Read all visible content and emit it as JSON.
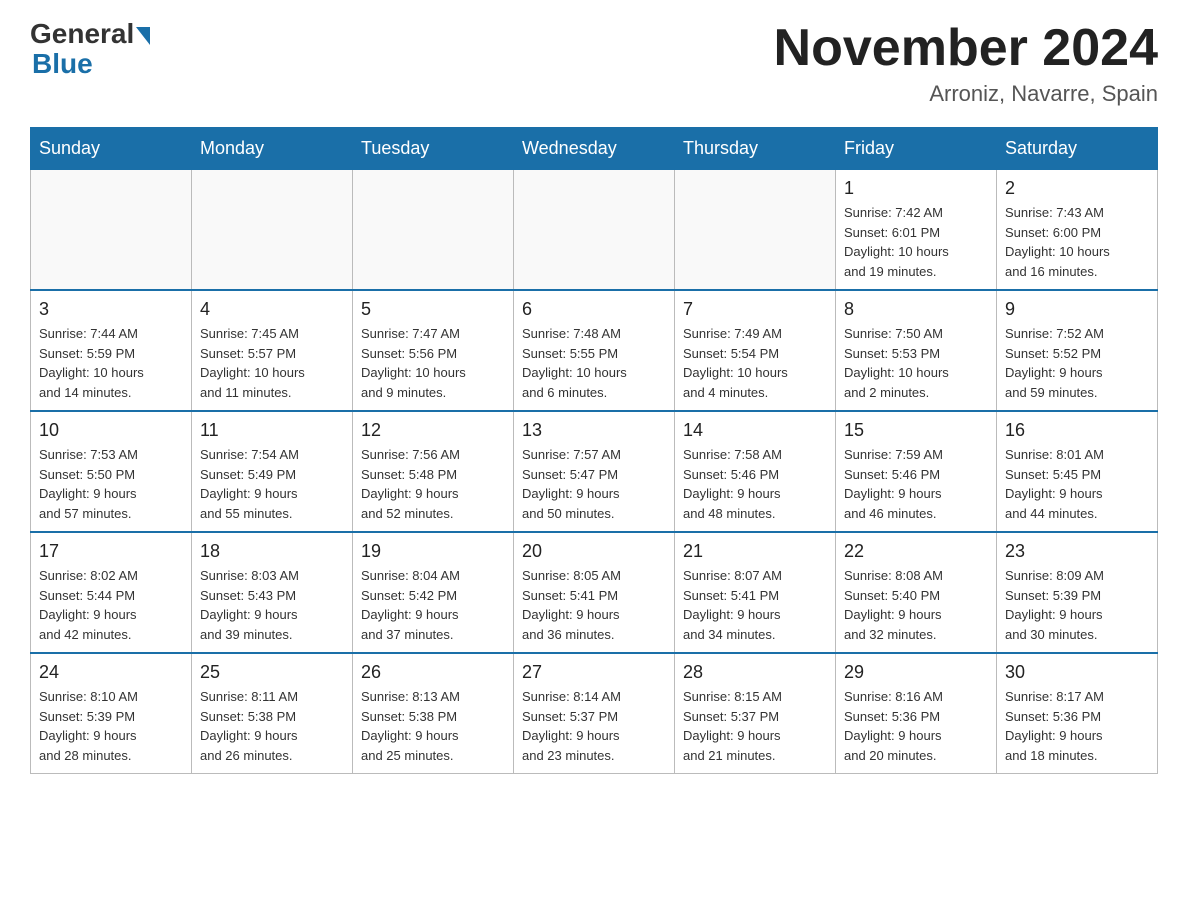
{
  "logo": {
    "general": "General",
    "blue": "Blue"
  },
  "title": "November 2024",
  "subtitle": "Arroniz, Navarre, Spain",
  "weekdays": [
    "Sunday",
    "Monday",
    "Tuesday",
    "Wednesday",
    "Thursday",
    "Friday",
    "Saturday"
  ],
  "weeks": [
    [
      {
        "day": "",
        "info": ""
      },
      {
        "day": "",
        "info": ""
      },
      {
        "day": "",
        "info": ""
      },
      {
        "day": "",
        "info": ""
      },
      {
        "day": "",
        "info": ""
      },
      {
        "day": "1",
        "info": "Sunrise: 7:42 AM\nSunset: 6:01 PM\nDaylight: 10 hours\nand 19 minutes."
      },
      {
        "day": "2",
        "info": "Sunrise: 7:43 AM\nSunset: 6:00 PM\nDaylight: 10 hours\nand 16 minutes."
      }
    ],
    [
      {
        "day": "3",
        "info": "Sunrise: 7:44 AM\nSunset: 5:59 PM\nDaylight: 10 hours\nand 14 minutes."
      },
      {
        "day": "4",
        "info": "Sunrise: 7:45 AM\nSunset: 5:57 PM\nDaylight: 10 hours\nand 11 minutes."
      },
      {
        "day": "5",
        "info": "Sunrise: 7:47 AM\nSunset: 5:56 PM\nDaylight: 10 hours\nand 9 minutes."
      },
      {
        "day": "6",
        "info": "Sunrise: 7:48 AM\nSunset: 5:55 PM\nDaylight: 10 hours\nand 6 minutes."
      },
      {
        "day": "7",
        "info": "Sunrise: 7:49 AM\nSunset: 5:54 PM\nDaylight: 10 hours\nand 4 minutes."
      },
      {
        "day": "8",
        "info": "Sunrise: 7:50 AM\nSunset: 5:53 PM\nDaylight: 10 hours\nand 2 minutes."
      },
      {
        "day": "9",
        "info": "Sunrise: 7:52 AM\nSunset: 5:52 PM\nDaylight: 9 hours\nand 59 minutes."
      }
    ],
    [
      {
        "day": "10",
        "info": "Sunrise: 7:53 AM\nSunset: 5:50 PM\nDaylight: 9 hours\nand 57 minutes."
      },
      {
        "day": "11",
        "info": "Sunrise: 7:54 AM\nSunset: 5:49 PM\nDaylight: 9 hours\nand 55 minutes."
      },
      {
        "day": "12",
        "info": "Sunrise: 7:56 AM\nSunset: 5:48 PM\nDaylight: 9 hours\nand 52 minutes."
      },
      {
        "day": "13",
        "info": "Sunrise: 7:57 AM\nSunset: 5:47 PM\nDaylight: 9 hours\nand 50 minutes."
      },
      {
        "day": "14",
        "info": "Sunrise: 7:58 AM\nSunset: 5:46 PM\nDaylight: 9 hours\nand 48 minutes."
      },
      {
        "day": "15",
        "info": "Sunrise: 7:59 AM\nSunset: 5:46 PM\nDaylight: 9 hours\nand 46 minutes."
      },
      {
        "day": "16",
        "info": "Sunrise: 8:01 AM\nSunset: 5:45 PM\nDaylight: 9 hours\nand 44 minutes."
      }
    ],
    [
      {
        "day": "17",
        "info": "Sunrise: 8:02 AM\nSunset: 5:44 PM\nDaylight: 9 hours\nand 42 minutes."
      },
      {
        "day": "18",
        "info": "Sunrise: 8:03 AM\nSunset: 5:43 PM\nDaylight: 9 hours\nand 39 minutes."
      },
      {
        "day": "19",
        "info": "Sunrise: 8:04 AM\nSunset: 5:42 PM\nDaylight: 9 hours\nand 37 minutes."
      },
      {
        "day": "20",
        "info": "Sunrise: 8:05 AM\nSunset: 5:41 PM\nDaylight: 9 hours\nand 36 minutes."
      },
      {
        "day": "21",
        "info": "Sunrise: 8:07 AM\nSunset: 5:41 PM\nDaylight: 9 hours\nand 34 minutes."
      },
      {
        "day": "22",
        "info": "Sunrise: 8:08 AM\nSunset: 5:40 PM\nDaylight: 9 hours\nand 32 minutes."
      },
      {
        "day": "23",
        "info": "Sunrise: 8:09 AM\nSunset: 5:39 PM\nDaylight: 9 hours\nand 30 minutes."
      }
    ],
    [
      {
        "day": "24",
        "info": "Sunrise: 8:10 AM\nSunset: 5:39 PM\nDaylight: 9 hours\nand 28 minutes."
      },
      {
        "day": "25",
        "info": "Sunrise: 8:11 AM\nSunset: 5:38 PM\nDaylight: 9 hours\nand 26 minutes."
      },
      {
        "day": "26",
        "info": "Sunrise: 8:13 AM\nSunset: 5:38 PM\nDaylight: 9 hours\nand 25 minutes."
      },
      {
        "day": "27",
        "info": "Sunrise: 8:14 AM\nSunset: 5:37 PM\nDaylight: 9 hours\nand 23 minutes."
      },
      {
        "day": "28",
        "info": "Sunrise: 8:15 AM\nSunset: 5:37 PM\nDaylight: 9 hours\nand 21 minutes."
      },
      {
        "day": "29",
        "info": "Sunrise: 8:16 AM\nSunset: 5:36 PM\nDaylight: 9 hours\nand 20 minutes."
      },
      {
        "day": "30",
        "info": "Sunrise: 8:17 AM\nSunset: 5:36 PM\nDaylight: 9 hours\nand 18 minutes."
      }
    ]
  ]
}
